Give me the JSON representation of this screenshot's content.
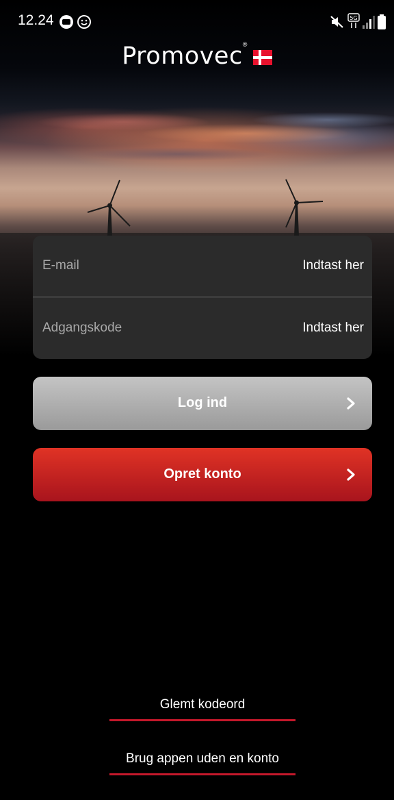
{
  "status_bar": {
    "time": "12.24",
    "icons": [
      "tv2-icon",
      "smiley-icon",
      "mute-icon",
      "5g-icon",
      "signal-icon",
      "battery-icon"
    ],
    "network_label": "5G"
  },
  "brand": {
    "name": "Promovec",
    "registered_mark": "®",
    "flag": "denmark-flag"
  },
  "login_form": {
    "email_label": "E-mail",
    "email_placeholder": "Indtast her",
    "email_value": "",
    "password_label": "Adgangskode",
    "password_placeholder": "Indtast her",
    "password_value": ""
  },
  "buttons": {
    "login_label": "Log ind",
    "create_account_label": "Opret konto"
  },
  "links": {
    "forgot_password": "Glemt kodeord",
    "use_without_account": "Brug appen uden en konto"
  },
  "colors": {
    "background": "#000000",
    "card": "#2b2b2b",
    "login_button": "#b0b0b0",
    "create_button": "#c41f24",
    "accent_underline": "#c4182b"
  }
}
